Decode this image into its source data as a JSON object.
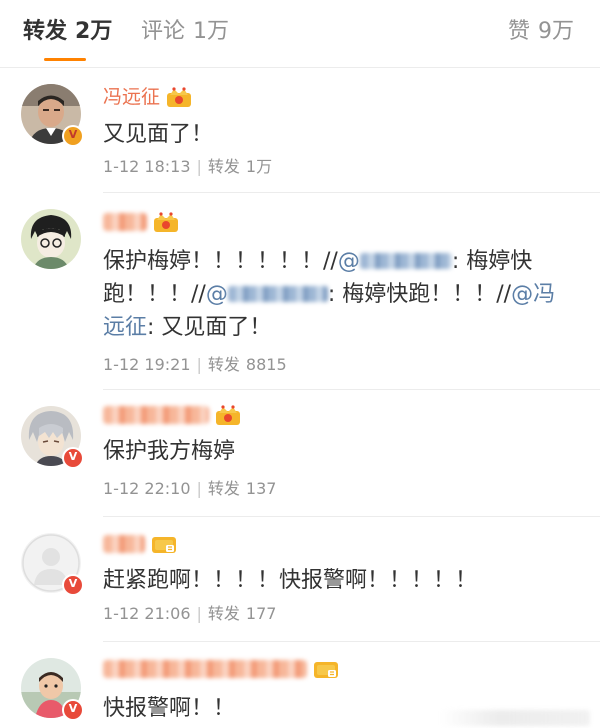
{
  "tabs": {
    "repost": {
      "label": "转发",
      "count": "2万"
    },
    "comment": {
      "label": "评论",
      "count": "1万"
    },
    "like": {
      "label": "赞",
      "count": "9万"
    }
  },
  "reposts": [
    {
      "name": "冯远征",
      "text": "又见面了！",
      "time": "1-12 18:13",
      "repost_label": "转发",
      "repost_count": "1万",
      "avatar": "avatar-photo-man",
      "verified": "yellow-v-badge"
    },
    {
      "name": "",
      "text_parts": [
        "保护梅婷！！！！！！//",
        "@",
        ": 梅婷快跑！！！//",
        "@",
        ": 梅婷快跑！！！//",
        "@冯远征",
        ": 又见面了！"
      ],
      "time": "1-12 19:21",
      "repost_label": "转发",
      "repost_count": "8815",
      "avatar": "avatar-anime-boy",
      "verified": "none"
    },
    {
      "name": "",
      "text": "保护我方梅婷",
      "time": "1-12 22:10",
      "repost_label": "转发",
      "repost_count": "137",
      "avatar": "avatar-anime-silver",
      "verified": "red-v-badge"
    },
    {
      "name": "",
      "text": "赶紧跑啊！！！！快报警啊！！！！！",
      "time": "1-12 21:06",
      "repost_label": "转发",
      "repost_count": "177",
      "avatar": "avatar-default-gray",
      "verified": "red-v-badge"
    },
    {
      "name": "",
      "text": "快报警啊！！",
      "avatar": "avatar-photo-child",
      "verified": "red-v-badge"
    }
  ],
  "colors": {
    "accent": "#ff8200",
    "username": "#eb7350",
    "mention": "#5b7ea6",
    "meta": "#939393",
    "text": "#333333"
  }
}
